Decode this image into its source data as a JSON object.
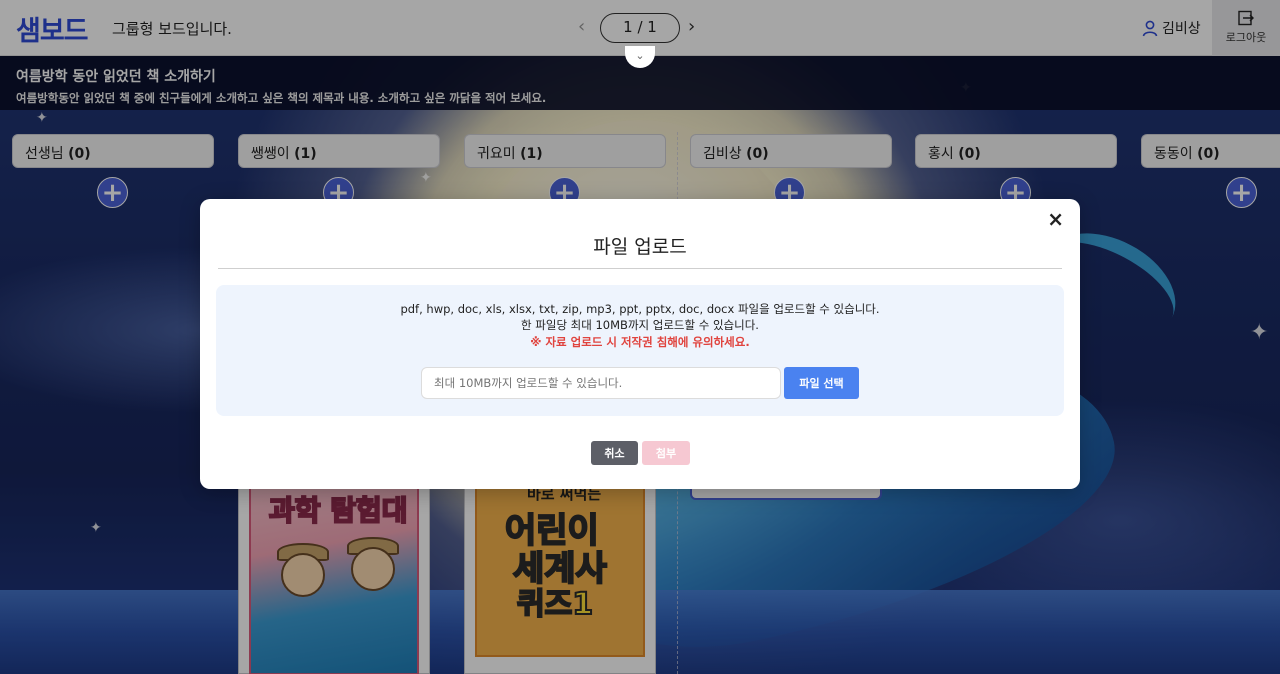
{
  "header": {
    "logo": "샘보드",
    "board_type": "그룹형 보드입니다.",
    "pager": {
      "prev": "‹",
      "label": "1 / 1",
      "next": "›"
    },
    "user_name": "김비상",
    "logout_label": "로그아웃"
  },
  "topic": {
    "title": "여름방학 동안 읽었던 책 소개하기",
    "description": "여름방학동안 읽었던 책 중에 친구들에게 소개하고 싶은 책의 제목과 내용. 소개하고 싶은 까닭을 적어 보세요."
  },
  "columns": [
    {
      "name": "선생님",
      "count": "(0)"
    },
    {
      "name": "쌩쌩이",
      "count": "(1)"
    },
    {
      "name": "귀요미",
      "count": "(1)"
    },
    {
      "name": "김비상",
      "count": "(0)"
    },
    {
      "name": "홍시",
      "count": "(0)"
    },
    {
      "name": "동동이",
      "count": "(0)"
    }
  ],
  "add_symbol": "+",
  "cards": {
    "book1_title": "과학 탐험대",
    "book2_subtitle": "바로 써먹는",
    "book2_title_line1": "어린이",
    "book2_title_line2": "세계사",
    "book2_title_line3": "퀴즈1"
  },
  "modal": {
    "title": "파일 업로드",
    "close": "×",
    "info_line1": "pdf, hwp, doc, xls, xlsx, txt, zip, mp3, ppt, pptx, doc, docx 파일을 업로드할 수 있습니다.",
    "info_line2": "한 파일당 최대 10MB까지 업로드할 수 있습니다.",
    "warning": "※ 자료 업로드 시 저작권 침해에 유의하세요.",
    "file_placeholder": "최대 10MB까지 업로드할 수 있습니다.",
    "file_button": "파일 선택",
    "cancel": "취소",
    "attach": "첨부"
  },
  "colors": {
    "brand": "#2f4bd6",
    "primary": "#4a82f0",
    "warning": "#e0433e",
    "attach_disabled": "#f6c8d2"
  }
}
